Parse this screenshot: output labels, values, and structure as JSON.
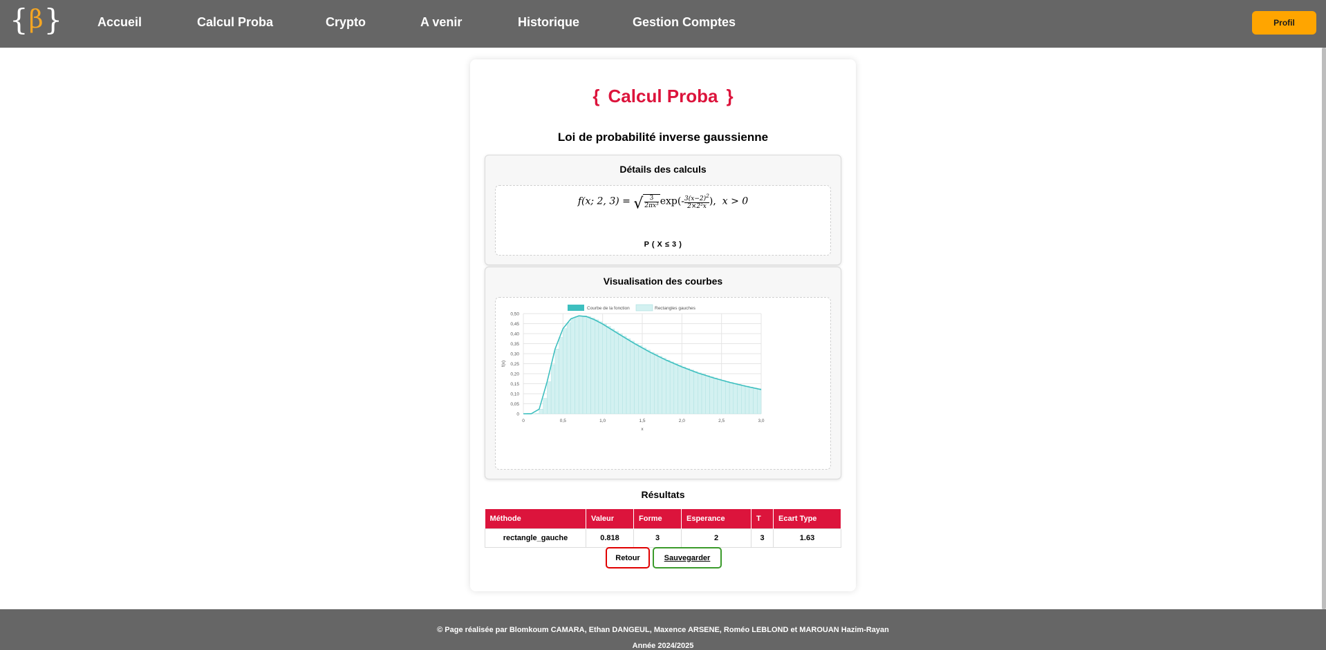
{
  "nav": {
    "logo": {
      "left_brace": "{",
      "symbol": "β",
      "right_brace": "}"
    },
    "links": [
      "Accueil",
      "Calcul Proba",
      "Crypto",
      "A venir",
      "Historique",
      "Gestion Comptes"
    ],
    "profile_button": "Profil"
  },
  "main": {
    "title_left_brace": "{",
    "title": "Calcul Proba",
    "title_right_brace": "}",
    "subtitle": "Loi de probabilité inverse gaussienne",
    "details": {
      "heading": "Détails des calculs",
      "formula": {
        "lhs": "f(x; 2, 3) =",
        "sqrt_num": "3",
        "sqrt_den": "2πx³",
        "exp": "exp(-",
        "exp_num": "3(x−2)",
        "exp_num_power": "2",
        "exp_den": "2×2²x",
        "tail": "),",
        "condition": "x > 0"
      },
      "probability": "P ( X ≤ 3 )"
    },
    "visualization": {
      "heading": "Visualisation des courbes"
    },
    "results": {
      "heading": "Résultats",
      "columns": [
        "Méthode",
        "Valeur",
        "Forme",
        "Esperance",
        "T",
        "Ecart Type"
      ],
      "rows": [
        [
          "rectangle_gauche",
          "0.818",
          "3",
          "2",
          "3",
          "1.63"
        ]
      ]
    },
    "buttons": {
      "back": "Retour",
      "save": "Sauvegarder"
    }
  },
  "footer": {
    "credits": "© Page réalisée par Blomkoum CAMARA, Ethan DANGEUL, Maxence ARSENE, Roméo LEBLOND et MAROUAN Hazim-Rayan",
    "year": "Année 2024/2025"
  },
  "colors": {
    "navbar": "#666666",
    "accent": "#dc143c",
    "profile_button": "#ffa500",
    "curve": "#3dbfbf",
    "rectangles_fill": "#d3f1f1",
    "back_border": "#e00000",
    "save_border": "#3a9a2a"
  },
  "chart_data": {
    "type": "line",
    "legend": [
      "Courbe de la fonction",
      "Rectangles gauches"
    ],
    "legend_position": "top",
    "xlabel": "x",
    "ylabel": "f(x)",
    "xlim": [
      0,
      3
    ],
    "ylim": [
      0,
      0.5
    ],
    "x_ticks": [
      "0",
      "0,5",
      "1,0",
      "1,5",
      "2,0",
      "2,5",
      "3,0"
    ],
    "y_ticks": [
      "0",
      "0,05",
      "0,10",
      "0,15",
      "0,20",
      "0,25",
      "0,30",
      "0,35",
      "0,40",
      "0,45",
      "0,50"
    ],
    "grid": true,
    "series": [
      {
        "name": "Courbe de la fonction",
        "x": [
          0,
          0.1,
          0.2,
          0.3,
          0.4,
          0.5,
          0.6,
          0.7,
          0.8,
          0.9,
          1.0,
          1.2,
          1.4,
          1.6,
          1.8,
          2.0,
          2.2,
          2.4,
          2.6,
          2.8,
          3.0
        ],
        "y": [
          0,
          0.0001,
          0.023,
          0.16,
          0.323,
          0.425,
          0.474,
          0.489,
          0.485,
          0.469,
          0.448,
          0.399,
          0.351,
          0.307,
          0.268,
          0.234,
          0.204,
          0.179,
          0.157,
          0.138,
          0.121
        ]
      },
      {
        "name": "Rectangles gauches",
        "x_start": 0,
        "step": 0.05,
        "values": [
          0,
          2e-05,
          0.0001,
          0.0013,
          0.023,
          0.077,
          0.16,
          0.245,
          0.323,
          0.381,
          0.425,
          0.455,
          0.474,
          0.485,
          0.489,
          0.489,
          0.485,
          0.478,
          0.469,
          0.459,
          0.448,
          0.436,
          0.424,
          0.411,
          0.399,
          0.387,
          0.375,
          0.363,
          0.351,
          0.34,
          0.329,
          0.318,
          0.307,
          0.297,
          0.287,
          0.278,
          0.268,
          0.259,
          0.251,
          0.242,
          0.234,
          0.226,
          0.219,
          0.211,
          0.204,
          0.198,
          0.191,
          0.185,
          0.179,
          0.173,
          0.167,
          0.162,
          0.157,
          0.152,
          0.147,
          0.142,
          0.138,
          0.133,
          0.129,
          0.125
        ]
      }
    ]
  }
}
